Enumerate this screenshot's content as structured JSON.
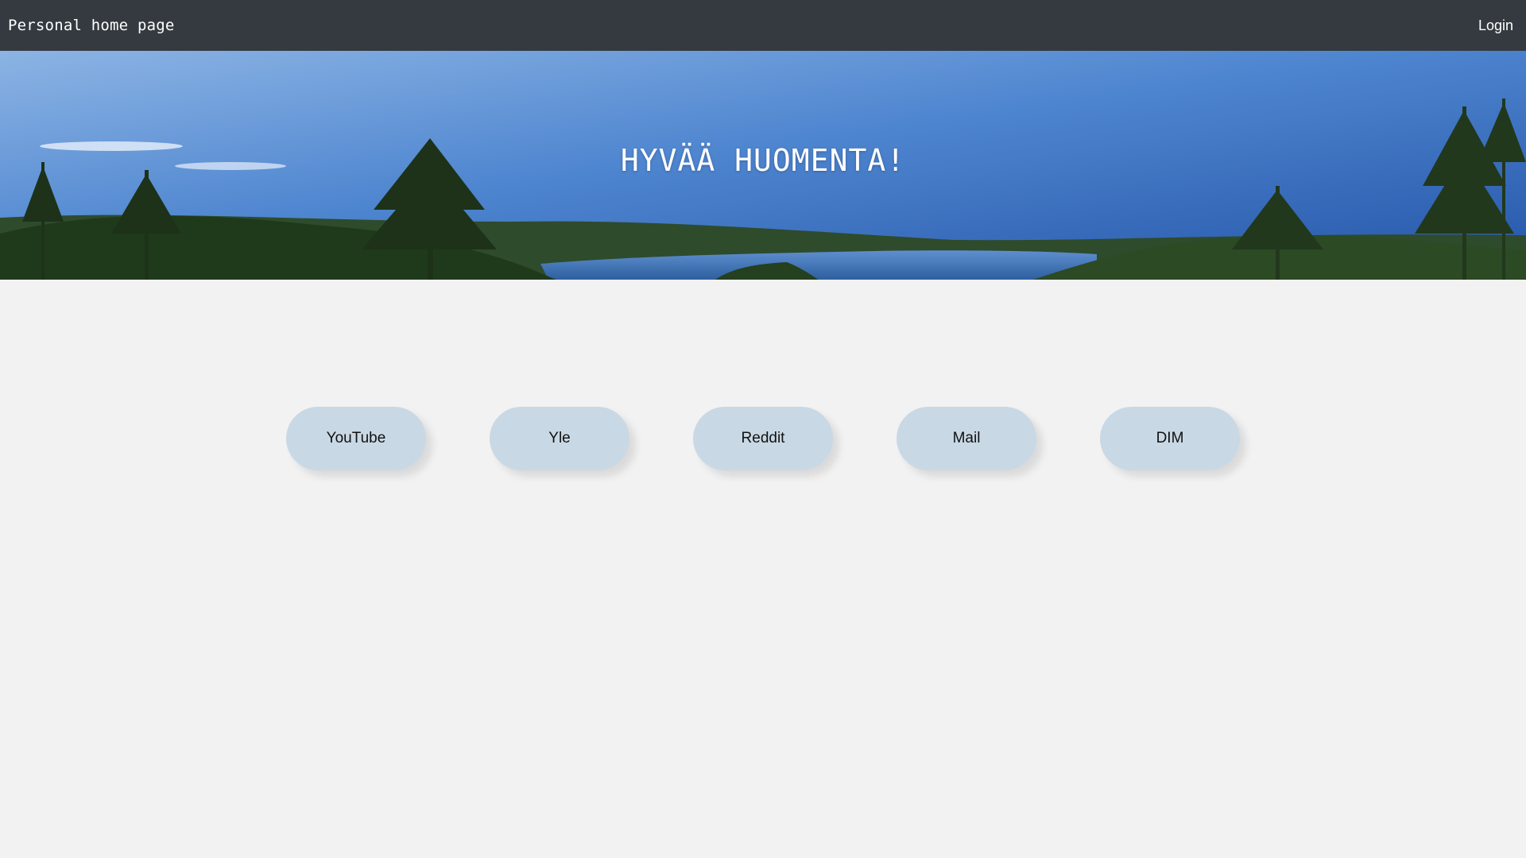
{
  "navbar": {
    "brand": "Personal home page",
    "login_label": "Login"
  },
  "hero": {
    "title": "HYVÄÄ HUOMENTA!"
  },
  "links": [
    {
      "label": "YouTube"
    },
    {
      "label": "Yle"
    },
    {
      "label": "Reddit"
    },
    {
      "label": "Mail"
    },
    {
      "label": "DIM"
    }
  ],
  "colors": {
    "navbar_bg": "#343a40",
    "page_bg": "#f2f2f2",
    "button_bg": "#c9d8e5"
  }
}
